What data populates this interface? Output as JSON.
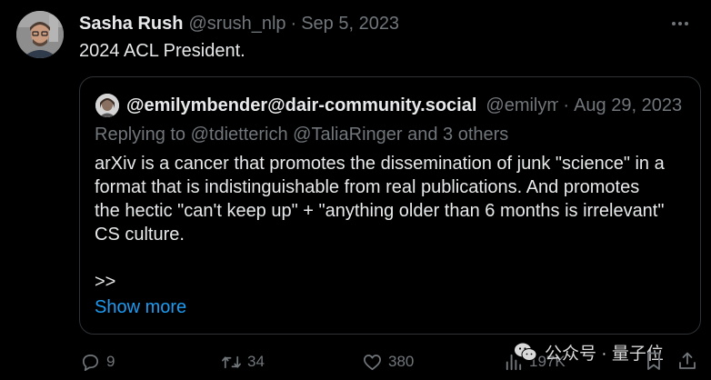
{
  "author": {
    "display_name": "Sasha Rush",
    "handle": "@srush_nlp",
    "separator": "·",
    "date": "Sep 5, 2023",
    "avatar_icon": "profile-photo"
  },
  "tweet": {
    "text": "2024 ACL President."
  },
  "quote": {
    "display_name": "@emilymbender@dair-community.social",
    "handle": "@emilym",
    "separator": "·",
    "date": "Aug 29, 2023",
    "replying_to": "Replying to @tdietterich @TaliaRinger and 3 others",
    "body_lines": [
      "arXiv is a cancer that promotes the dissemination of junk \"science\" in a",
      "format that is indistinguishable from real publications. And promotes",
      "the hectic \"can't keep up\" + \"anything older than 6 months is irrelevant\"",
      "CS culture.",
      "",
      ">>"
    ],
    "show_more": "Show more"
  },
  "actions": {
    "reply_count": "9",
    "retweet_count": "34",
    "like_count": "380",
    "view_count": "197K"
  },
  "watermark": {
    "text": "公众号 · 量子位"
  },
  "colors": {
    "background": "#000000",
    "primary_text": "#e7e9ea",
    "secondary_text": "#71767b",
    "link": "#1d9bf0",
    "border": "#2f3336"
  }
}
